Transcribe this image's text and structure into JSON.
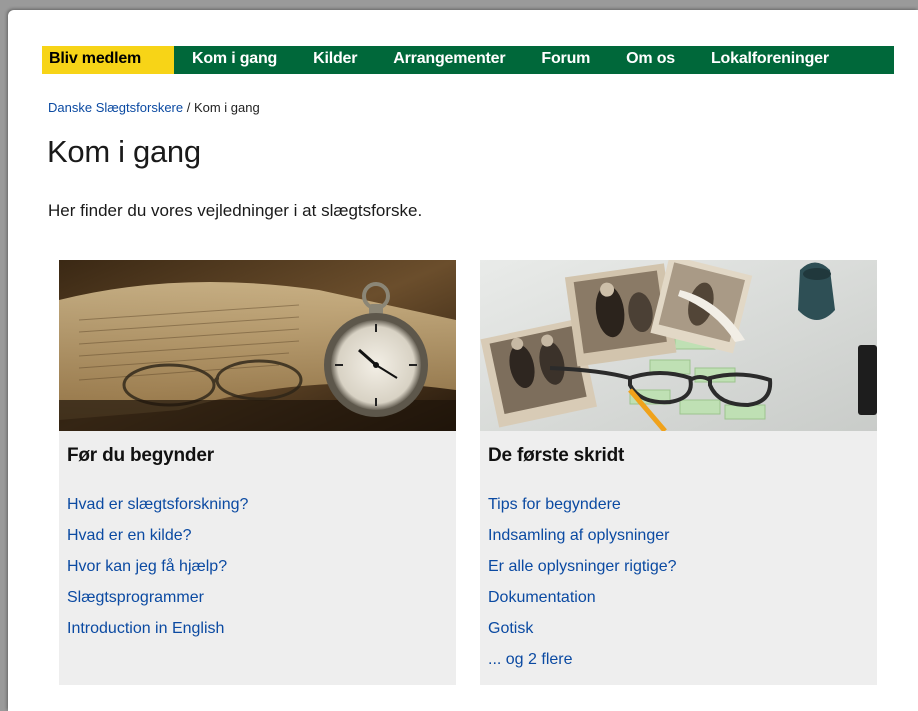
{
  "nav": {
    "items": [
      {
        "label": "Bliv medlem"
      },
      {
        "label": "Kom i gang"
      },
      {
        "label": "Kilder"
      },
      {
        "label": "Arrangementer"
      },
      {
        "label": "Forum"
      },
      {
        "label": "Om os"
      },
      {
        "label": "Lokalforeninger"
      }
    ],
    "highlight_color": "#f7d417",
    "bar_color": "#00683a"
  },
  "breadcrumb": {
    "home": "Danske Slægtsforskere",
    "separator": " / ",
    "current": "Kom i gang"
  },
  "page": {
    "title": "Kom i gang",
    "intro": "Her finder du vores vejledninger i at slægtsforske."
  },
  "cards": [
    {
      "title": "Før du begynder",
      "image": "pocket-watch-on-old-book",
      "links": [
        "Hvad er slægtsforskning?",
        "Hvad er en kilde?",
        "Hvor kan jeg få hjælp?",
        "Slægtsprogrammer",
        "Introduction in English"
      ]
    },
    {
      "title": "De første skridt",
      "image": "old-photos-and-glasses",
      "links": [
        "Tips for begyndere",
        "Indsamling af oplysninger",
        "Er alle oplysninger rigtige?",
        "Dokumentation",
        "Gotisk",
        "... og 2 flere"
      ]
    }
  ]
}
